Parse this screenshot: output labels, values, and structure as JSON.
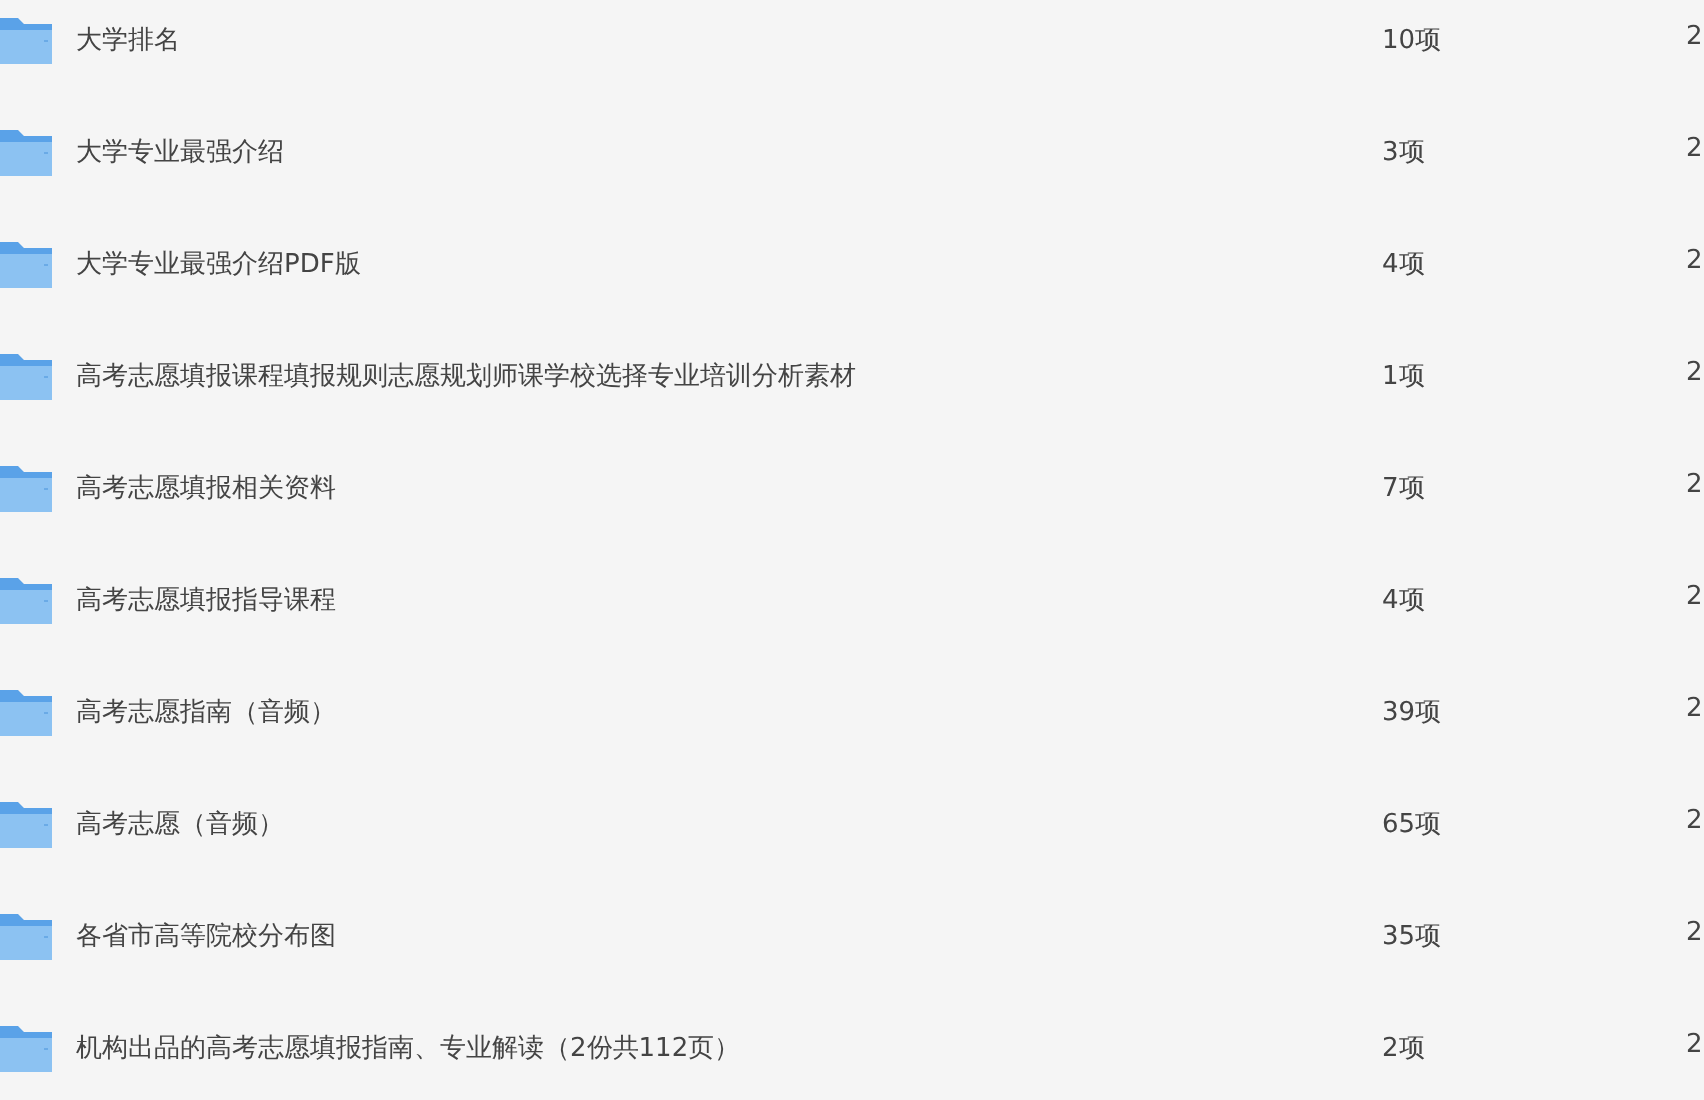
{
  "rows": [
    {
      "name": "大学排名",
      "count": "10项",
      "column_3": "2"
    },
    {
      "name": "大学专业最强介绍",
      "count": "3项",
      "column_3": "2"
    },
    {
      "name": "大学专业最强介绍PDF版",
      "count": "4项",
      "column_3": "2"
    },
    {
      "name": "高考志愿填报课程填报规则志愿规划师课学校选择专业培训分析素材",
      "count": "1项",
      "column_3": "2"
    },
    {
      "name": "高考志愿填报相关资料",
      "count": "7项",
      "column_3": "2"
    },
    {
      "name": "高考志愿填报指导课程",
      "count": "4项",
      "column_3": "2"
    },
    {
      "name": "高考志愿指南（音频）",
      "count": "39项",
      "column_3": "2"
    },
    {
      "name": "高考志愿（音频）",
      "count": "65项",
      "column_3": "2"
    },
    {
      "name": "各省市高等院校分布图",
      "count": "35项",
      "column_3": "2"
    },
    {
      "name": "机构出品的高考志愿填报指南、专业解读（2份共112页）",
      "count": "2项",
      "column_3": "2"
    }
  ]
}
